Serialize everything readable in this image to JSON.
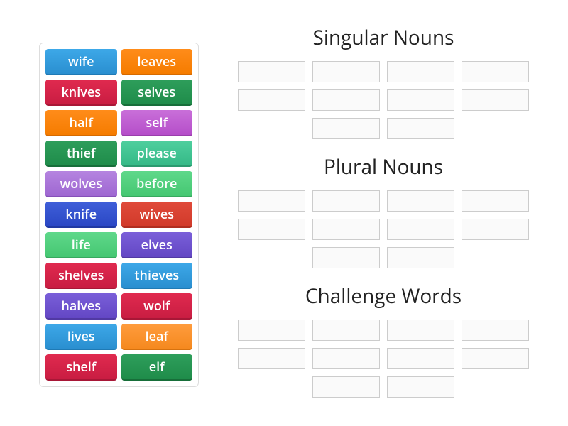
{
  "word_bank": [
    {
      "label": "wife",
      "color": "c-blue"
    },
    {
      "label": "leaves",
      "color": "c-orange"
    },
    {
      "label": "knives",
      "color": "c-crimson"
    },
    {
      "label": "selves",
      "color": "c-green"
    },
    {
      "label": "half",
      "color": "c-orange"
    },
    {
      "label": "self",
      "color": "c-purple"
    },
    {
      "label": "thief",
      "color": "c-green"
    },
    {
      "label": "please",
      "color": "c-teal"
    },
    {
      "label": "wolves",
      "color": "c-violet"
    },
    {
      "label": "before",
      "color": "c-mint"
    },
    {
      "label": "knife",
      "color": "c-navy"
    },
    {
      "label": "wives",
      "color": "c-red"
    },
    {
      "label": "life",
      "color": "c-mint"
    },
    {
      "label": "elves",
      "color": "c-indigo"
    },
    {
      "label": "shelves",
      "color": "c-crimson"
    },
    {
      "label": "thieves",
      "color": "c-blue"
    },
    {
      "label": "halves",
      "color": "c-indigo"
    },
    {
      "label": "wolf",
      "color": "c-crimson"
    },
    {
      "label": "lives",
      "color": "c-blue"
    },
    {
      "label": "leaf",
      "color": "c-orange2"
    },
    {
      "label": "shelf",
      "color": "c-crimson"
    },
    {
      "label": "elf",
      "color": "c-green"
    }
  ],
  "groups": [
    {
      "title": "Singular Nouns",
      "slot_count": 10
    },
    {
      "title": "Plural Nouns",
      "slot_count": 10
    },
    {
      "title": "Challenge Words",
      "slot_count": 10
    }
  ]
}
